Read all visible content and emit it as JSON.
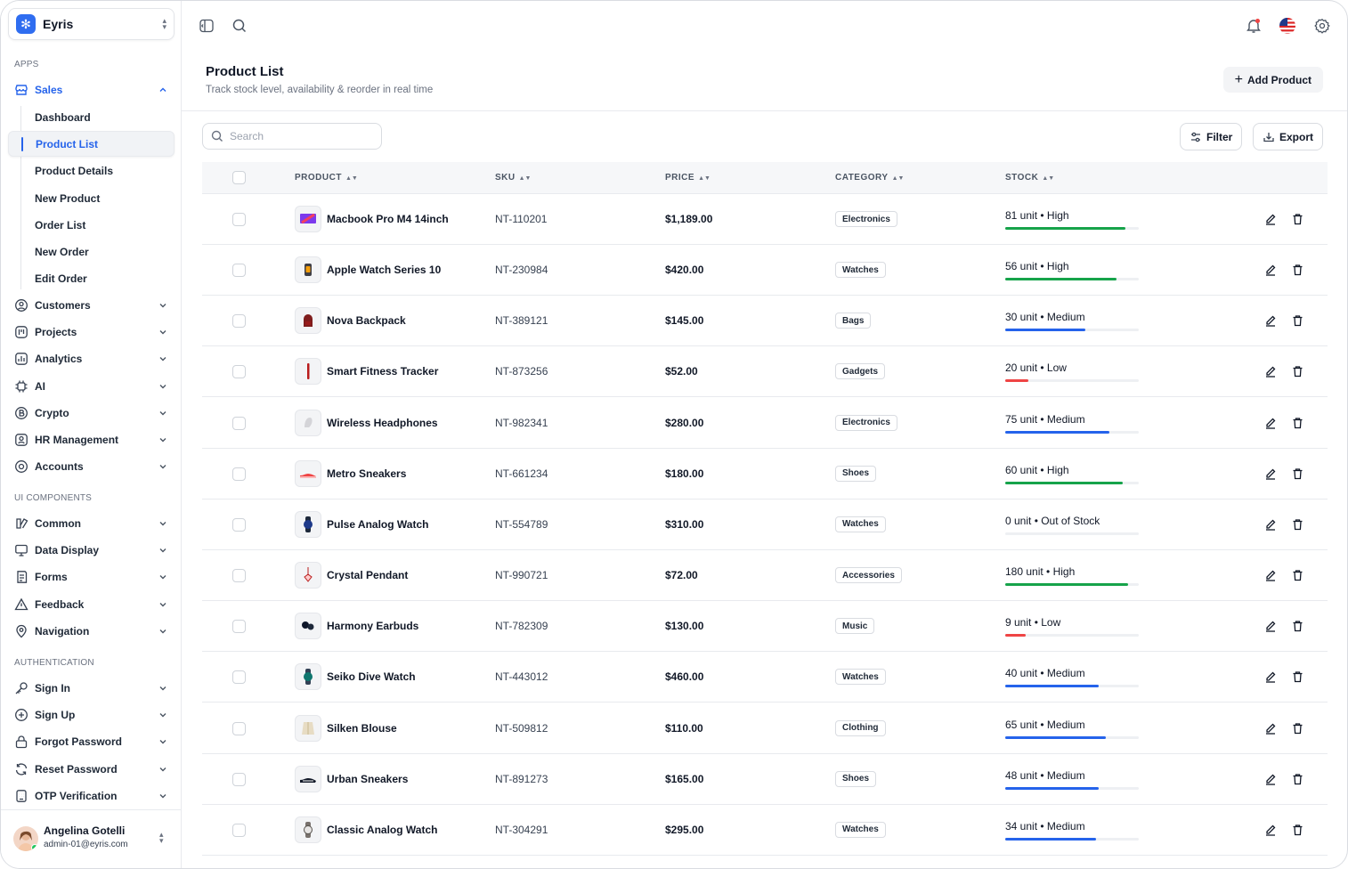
{
  "app": {
    "name": "Eyris"
  },
  "sidebar": {
    "section_apps": "APPS",
    "sales": {
      "label": "Sales",
      "subitems": [
        "Dashboard",
        "Product List",
        "Product Details",
        "New Product",
        "Order List",
        "New Order",
        "Edit Order"
      ],
      "active": "Product List"
    },
    "apps": [
      {
        "label": "Customers",
        "icon": "customers-icon"
      },
      {
        "label": "Projects",
        "icon": "projects-icon"
      },
      {
        "label": "Analytics",
        "icon": "analytics-icon"
      },
      {
        "label": "AI",
        "icon": "ai-chip-icon"
      },
      {
        "label": "Crypto",
        "icon": "crypto-icon"
      },
      {
        "label": "HR Management",
        "icon": "hr-icon"
      },
      {
        "label": "Accounts",
        "icon": "accounts-icon"
      }
    ],
    "section_ui": "UI COMPONENTS",
    "ui": [
      {
        "label": "Common",
        "icon": "common-icon"
      },
      {
        "label": "Data Display",
        "icon": "data-display-icon"
      },
      {
        "label": "Forms",
        "icon": "forms-icon"
      },
      {
        "label": "Feedback",
        "icon": "feedback-icon"
      },
      {
        "label": "Navigation",
        "icon": "navigation-icon"
      }
    ],
    "section_auth": "AUTHENTICATION",
    "auth": [
      {
        "label": "Sign In",
        "icon": "sign-in-icon"
      },
      {
        "label": "Sign Up",
        "icon": "sign-up-icon"
      },
      {
        "label": "Forgot Password",
        "icon": "forgot-password-icon"
      },
      {
        "label": "Reset Password",
        "icon": "reset-password-icon"
      },
      {
        "label": "OTP Verification",
        "icon": "otp-icon"
      }
    ],
    "user": {
      "name": "Angelina Gotelli",
      "email": "admin-01@eyris.com"
    }
  },
  "header": {
    "title": "Product List",
    "subtitle": "Track stock level, availability & reorder in real time",
    "add_button": "Add Product"
  },
  "toolbar": {
    "search_placeholder": "Search",
    "filter": "Filter",
    "export": "Export"
  },
  "table": {
    "columns": [
      "PRODUCT",
      "SKU",
      "PRICE",
      "CATEGORY",
      "STOCK"
    ],
    "rows": [
      {
        "name": "Macbook Pro M4 14inch",
        "sku": "NT-110201",
        "price": "$1,189.00",
        "category": "Electronics",
        "stock": "81 unit • High",
        "level": 0.9,
        "status": "high"
      },
      {
        "name": "Apple Watch Series 10",
        "sku": "NT-230984",
        "price": "$420.00",
        "category": "Watches",
        "stock": "56 unit • High",
        "level": 0.83,
        "status": "high"
      },
      {
        "name": "Nova Backpack",
        "sku": "NT-389121",
        "price": "$145.00",
        "category": "Bags",
        "stock": "30 unit • Medium",
        "level": 0.6,
        "status": "medium"
      },
      {
        "name": "Smart Fitness Tracker",
        "sku": "NT-873256",
        "price": "$52.00",
        "category": "Gadgets",
        "stock": "20 unit • Low",
        "level": 0.17,
        "status": "low"
      },
      {
        "name": "Wireless Headphones",
        "sku": "NT-982341",
        "price": "$280.00",
        "category": "Electronics",
        "stock": "75 unit • Medium",
        "level": 0.78,
        "status": "medium"
      },
      {
        "name": "Metro Sneakers",
        "sku": "NT-661234",
        "price": "$180.00",
        "category": "Shoes",
        "stock": "60 unit • High",
        "level": 0.88,
        "status": "high"
      },
      {
        "name": "Pulse Analog Watch",
        "sku": "NT-554789",
        "price": "$310.00",
        "category": "Watches",
        "stock": "0 unit • Out of Stock",
        "level": 0,
        "status": "out"
      },
      {
        "name": "Crystal Pendant",
        "sku": "NT-990721",
        "price": "$72.00",
        "category": "Accessories",
        "stock": "180 unit • High",
        "level": 0.92,
        "status": "high"
      },
      {
        "name": "Harmony Earbuds",
        "sku": "NT-782309",
        "price": "$130.00",
        "category": "Music",
        "stock": "9 unit • Low",
        "level": 0.15,
        "status": "low"
      },
      {
        "name": "Seiko Dive Watch",
        "sku": "NT-443012",
        "price": "$460.00",
        "category": "Watches",
        "stock": "40 unit • Medium",
        "level": 0.7,
        "status": "medium"
      },
      {
        "name": "Silken Blouse",
        "sku": "NT-509812",
        "price": "$110.00",
        "category": "Clothing",
        "stock": "65 unit • Medium",
        "level": 0.75,
        "status": "medium"
      },
      {
        "name": "Urban Sneakers",
        "sku": "NT-891273",
        "price": "$165.00",
        "category": "Shoes",
        "stock": "48 unit • Medium",
        "level": 0.7,
        "status": "medium"
      },
      {
        "name": "Classic Analog Watch",
        "sku": "NT-304291",
        "price": "$295.00",
        "category": "Watches",
        "stock": "34 unit • Medium",
        "level": 0.68,
        "status": "medium"
      }
    ]
  },
  "colors": {
    "accent": "#2563eb",
    "high": "#16a34a",
    "medium": "#2563eb",
    "low": "#ef4444"
  }
}
